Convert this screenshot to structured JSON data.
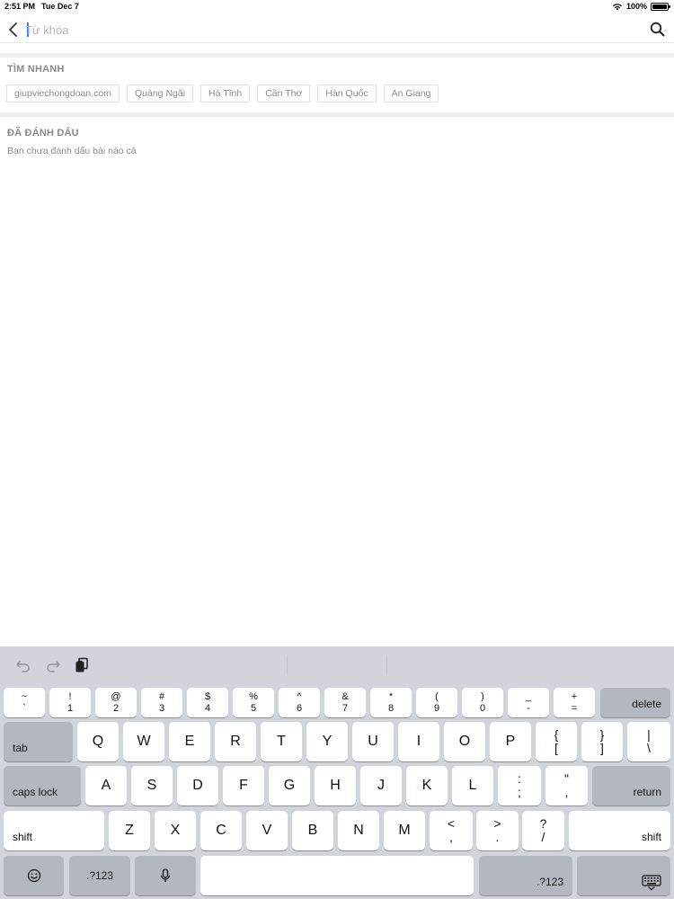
{
  "status": {
    "time": "2:51 PM",
    "date": "Tue Dec 7",
    "battery": "100%"
  },
  "search": {
    "placeholder": "Từ khóa",
    "value": ""
  },
  "quick_search": {
    "title": "TÌM NHANH",
    "chips": [
      "giupviechongdoan.com",
      "Quảng Ngãi",
      "Hà Tĩnh",
      "Cần Thơ",
      "Hàn Quốc",
      "An Giang"
    ]
  },
  "bookmarks": {
    "title": "ĐÃ ĐÁNH DẤU",
    "empty_text": "Bạn chưa đánh dấu bài nào cả"
  },
  "keyboard": {
    "row1": [
      {
        "top": "~",
        "bottom": "`"
      },
      {
        "top": "!",
        "bottom": "1"
      },
      {
        "top": "@",
        "bottom": "2"
      },
      {
        "top": "#",
        "bottom": "3"
      },
      {
        "top": "$",
        "bottom": "4"
      },
      {
        "top": "%",
        "bottom": "5"
      },
      {
        "top": "^",
        "bottom": "6"
      },
      {
        "top": "&",
        "bottom": "7"
      },
      {
        "top": "*",
        "bottom": "8"
      },
      {
        "top": "(",
        "bottom": "9"
      },
      {
        "top": ")",
        "bottom": "0"
      },
      {
        "top": "_",
        "bottom": "-"
      },
      {
        "top": "+",
        "bottom": "="
      }
    ],
    "delete_label": "delete",
    "tab_label": "tab",
    "row2": [
      "Q",
      "W",
      "E",
      "R",
      "T",
      "Y",
      "U",
      "I",
      "O",
      "P"
    ],
    "row2_sym": [
      {
        "top": "{",
        "bottom": "["
      },
      {
        "top": "}",
        "bottom": "]"
      },
      {
        "top": "|",
        "bottom": "\\"
      }
    ],
    "caps_label": "caps lock",
    "row3": [
      "A",
      "S",
      "D",
      "F",
      "G",
      "H",
      "J",
      "K",
      "L"
    ],
    "row3_sym": [
      {
        "top": ":",
        "bottom": ";"
      },
      {
        "top": "\"",
        "bottom": ","
      }
    ],
    "return_label": "return",
    "shift_label": "shift",
    "row4": [
      "Z",
      "X",
      "C",
      "V",
      "B",
      "N",
      "M"
    ],
    "row4_sym": [
      {
        "top": "<",
        "bottom": ","
      },
      {
        "top": ">",
        "bottom": "."
      },
      {
        "top": "?",
        "bottom": "/"
      }
    ],
    "num_label": ".?123"
  }
}
